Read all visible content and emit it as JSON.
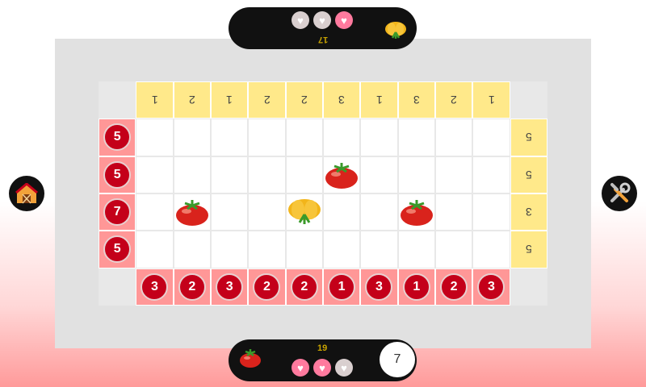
{
  "top_player": {
    "score": "17",
    "hearts": [
      "off",
      "off",
      "on"
    ],
    "fruit": "pumpkin-icon"
  },
  "bottom_player": {
    "score": "19",
    "hearts": [
      "on",
      "on",
      "off"
    ],
    "fruit": "tomato-icon",
    "moves": "7"
  },
  "buttons": {
    "left": "barn-icon",
    "right": "tools-icon"
  },
  "grid": {
    "top_clues": [
      "1",
      "2",
      "1",
      "2",
      "2",
      "3",
      "1",
      "3",
      "2",
      "1"
    ],
    "bottom_clues": [
      "3",
      "2",
      "3",
      "2",
      "2",
      "1",
      "3",
      "1",
      "2",
      "3"
    ],
    "left_clues": [
      "5",
      "5",
      "7",
      "5"
    ],
    "right_clues": [
      "5",
      "5",
      "3",
      "5"
    ],
    "pieces": [
      {
        "row": 1,
        "col": 5,
        "type": "tomato"
      },
      {
        "row": 2,
        "col": 1,
        "type": "tomato"
      },
      {
        "row": 2,
        "col": 4,
        "type": "pumpkin"
      },
      {
        "row": 2,
        "col": 7,
        "type": "tomato"
      }
    ]
  },
  "colors": {
    "clue_red": "#c4001a",
    "clue_yellow": "#ffe98a",
    "heart_on": "#ff7a9e"
  }
}
